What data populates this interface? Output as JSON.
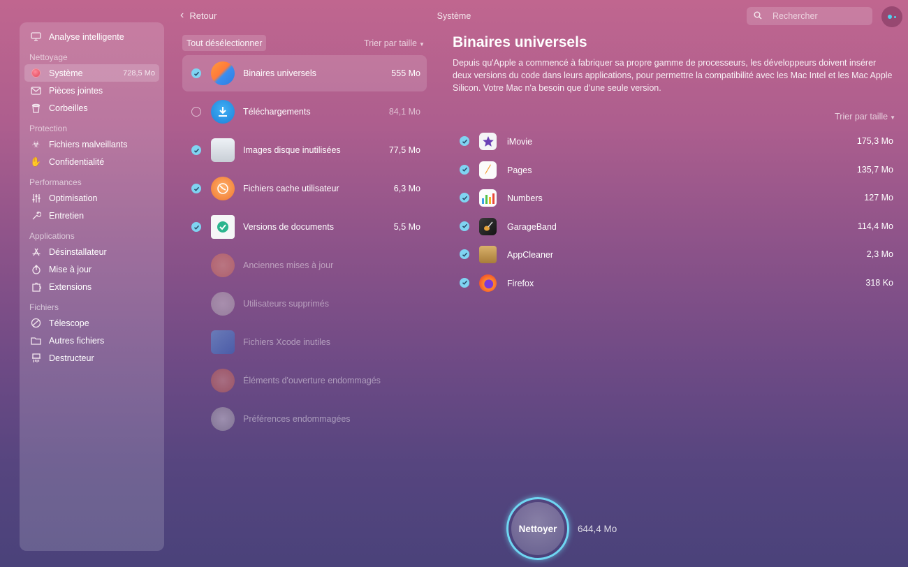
{
  "topbar": {
    "back_label": "Retour",
    "title": "Système",
    "search_placeholder": "Rechercher"
  },
  "sidebar": {
    "top_item": {
      "label": "Analyse intelligente",
      "icon": "monitor-icon"
    },
    "sections": [
      {
        "title": "Nettoyage",
        "items": [
          {
            "label": "Système",
            "size": "728,5 Mo",
            "icon": "system-junk-icon",
            "active": true
          },
          {
            "label": "Pièces jointes",
            "icon": "envelope-icon"
          },
          {
            "label": "Corbeilles",
            "icon": "trash-bin-icon"
          }
        ]
      },
      {
        "title": "Protection",
        "items": [
          {
            "label": "Fichiers malveillants",
            "icon": "biohazard-icon"
          },
          {
            "label": "Confidentialité",
            "icon": "hand-icon"
          }
        ]
      },
      {
        "title": "Performances",
        "items": [
          {
            "label": "Optimisation",
            "icon": "sliders-icon"
          },
          {
            "label": "Entretien",
            "icon": "wrench-icon"
          }
        ]
      },
      {
        "title": "Applications",
        "items": [
          {
            "label": "Désinstallateur",
            "icon": "app-store-icon"
          },
          {
            "label": "Mise à jour",
            "icon": "update-icon"
          },
          {
            "label": "Extensions",
            "icon": "extensions-icon"
          }
        ]
      },
      {
        "title": "Fichiers",
        "items": [
          {
            "label": "Télescope",
            "icon": "lens-icon"
          },
          {
            "label": "Autres fichiers",
            "icon": "folder-icon"
          },
          {
            "label": "Destructeur",
            "icon": "shredder-icon"
          }
        ]
      }
    ]
  },
  "list": {
    "deselect_label": "Tout désélectionner",
    "sort_label": "Trier par taille",
    "categories": [
      {
        "label": "Binaires universels",
        "size": "555 Mo",
        "checked": true,
        "selected": true,
        "icon": "universal-binaries-icon"
      },
      {
        "label": "Téléchargements",
        "size": "84,1 Mo",
        "checked": false,
        "icon": "downloads-icon"
      },
      {
        "label": "Images disque inutilisées",
        "size": "77,5 Mo",
        "checked": true,
        "icon": "disk-image-icon"
      },
      {
        "label": "Fichiers cache utilisateur",
        "size": "6,3 Mo",
        "checked": true,
        "icon": "cache-icon"
      },
      {
        "label": "Versions de documents",
        "size": "5,5 Mo",
        "checked": true,
        "icon": "document-versions-icon"
      },
      {
        "label": "Anciennes mises à jour",
        "dim": true,
        "icon": "old-updates-icon"
      },
      {
        "label": "Utilisateurs supprimés",
        "dim": true,
        "icon": "deleted-users-icon"
      },
      {
        "label": "Fichiers Xcode inutiles",
        "dim": true,
        "icon": "xcode-icon"
      },
      {
        "label": "Éléments d'ouverture endommagés",
        "dim": true,
        "icon": "broken-login-items-icon"
      },
      {
        "label": "Préférences endommagées",
        "dim": true,
        "icon": "broken-preferences-icon"
      }
    ]
  },
  "detail": {
    "title": "Binaires universels",
    "description": "Depuis qu'Apple a commencé à fabriquer sa propre gamme de processeurs, les développeurs doivent insérer deux versions du code dans leurs applications, pour permettre la compatibilité avec les Mac Intel et les Mac Apple Silicon. Votre Mac n'a besoin que d'une seule version.",
    "sort_label": "Trier par taille",
    "apps": [
      {
        "label": "iMovie",
        "size": "175,3 Mo",
        "icon": "imovie-icon"
      },
      {
        "label": "Pages",
        "size": "135,7 Mo",
        "icon": "pages-icon"
      },
      {
        "label": "Numbers",
        "size": "127 Mo",
        "icon": "numbers-icon"
      },
      {
        "label": "GarageBand",
        "size": "114,4 Mo",
        "icon": "garageband-icon"
      },
      {
        "label": "AppCleaner",
        "size": "2,3 Mo",
        "icon": "appcleaner-icon"
      },
      {
        "label": "Firefox",
        "size": "318 Ko",
        "icon": "firefox-icon"
      }
    ]
  },
  "footer": {
    "clean_label": "Nettoyer",
    "total_size": "644,4 Mo"
  },
  "colors": {
    "accent": "#7fd4f2",
    "ring": "#6fd6f2"
  }
}
